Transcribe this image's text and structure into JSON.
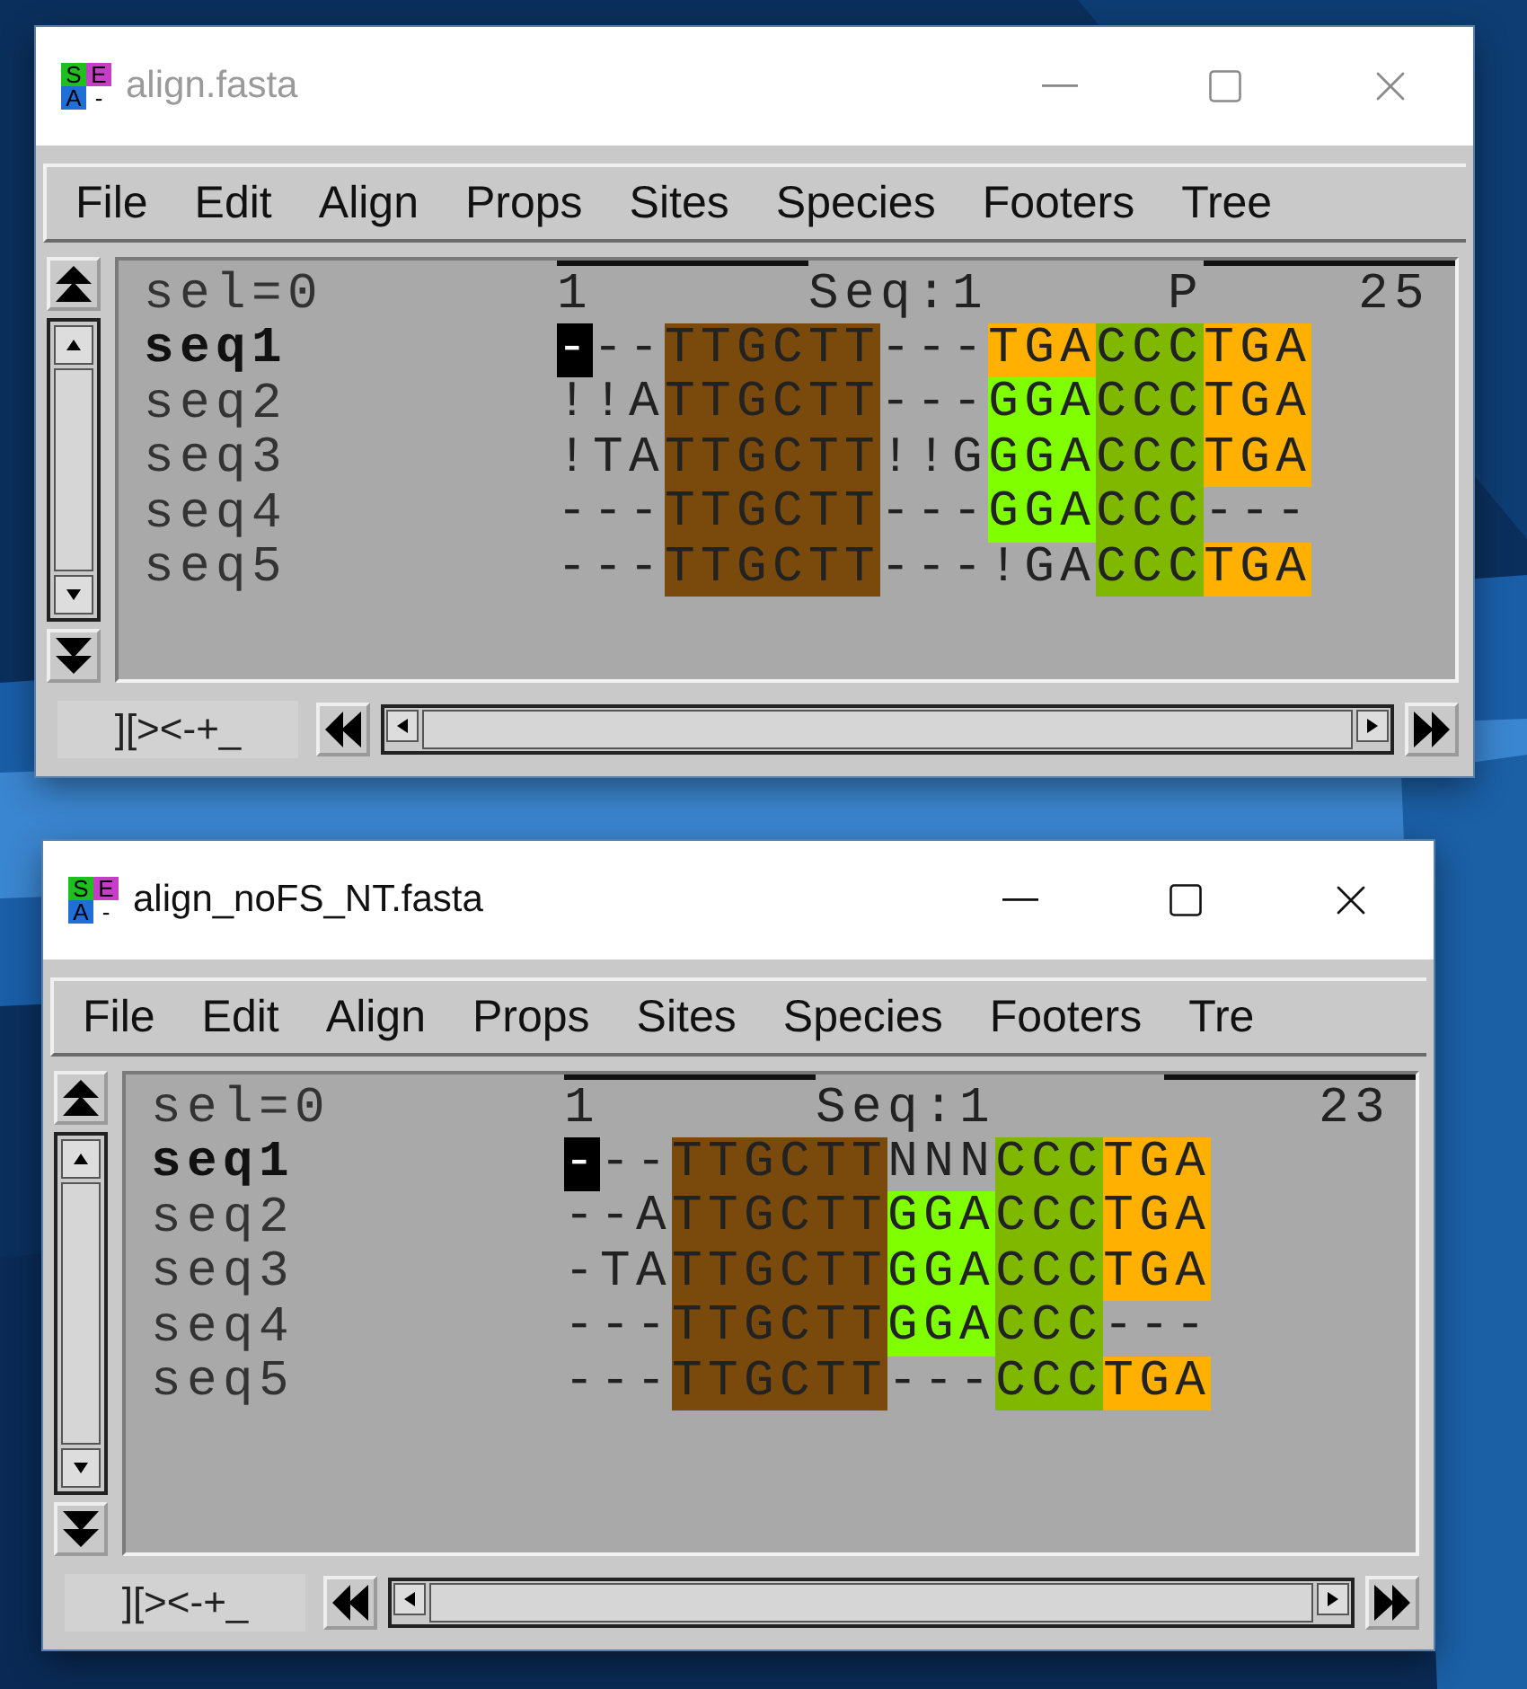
{
  "windows": [
    {
      "title": "align.fasta",
      "active": false,
      "logo": [
        "S",
        "E",
        "A",
        "-"
      ],
      "menu": [
        "File",
        "Edit",
        "Align",
        "Props",
        "Sites",
        "Species",
        "Footers",
        "Tree"
      ],
      "header": {
        "selection": "sel=0",
        "ruler": [
          "1",
          "Seq:1",
          "P"
        ],
        "length": "25"
      },
      "sequences": [
        {
          "name": "seq1",
          "reference": true,
          "segments": [
            {
              "text": "-",
              "kind": "cursor"
            },
            {
              "text": "--"
            },
            {
              "text": "TTGCTT",
              "color": "#7a4a0c"
            },
            {
              "text": "---"
            },
            {
              "text": "TGA",
              "color": "#ffb000"
            },
            {
              "text": "CCC",
              "color": "#80b800"
            },
            {
              "text": "TGA",
              "color": "#ffb000"
            }
          ]
        },
        {
          "name": "seq2",
          "reference": false,
          "segments": [
            {
              "text": "!!A"
            },
            {
              "text": "TTGCTT",
              "color": "#7a4a0c"
            },
            {
              "text": "---"
            },
            {
              "text": "GGA",
              "color": "#80ff00"
            },
            {
              "text": "CCC",
              "color": "#80b800"
            },
            {
              "text": "TGA",
              "color": "#ffb000"
            }
          ]
        },
        {
          "name": "seq3",
          "reference": false,
          "segments": [
            {
              "text": "!TA"
            },
            {
              "text": "TTGCTT",
              "color": "#7a4a0c"
            },
            {
              "text": "!!G"
            },
            {
              "text": "GGA",
              "color": "#80ff00"
            },
            {
              "text": "CCC",
              "color": "#80b800"
            },
            {
              "text": "TGA",
              "color": "#ffb000"
            }
          ]
        },
        {
          "name": "seq4",
          "reference": false,
          "segments": [
            {
              "text": "---"
            },
            {
              "text": "TTGCTT",
              "color": "#7a4a0c"
            },
            {
              "text": "---"
            },
            {
              "text": "GGA",
              "color": "#80ff00"
            },
            {
              "text": "CCC",
              "color": "#80b800"
            },
            {
              "text": "---"
            }
          ]
        },
        {
          "name": "seq5",
          "reference": false,
          "segments": [
            {
              "text": "---"
            },
            {
              "text": "TTGCTT",
              "color": "#7a4a0c"
            },
            {
              "text": "---"
            },
            {
              "text": "!GA"
            },
            {
              "text": "CCC",
              "color": "#80b800"
            },
            {
              "text": "TGA",
              "color": "#ffb000"
            }
          ]
        }
      ],
      "toggle": "][><-+_"
    },
    {
      "title": "align_noFS_NT.fasta",
      "active": true,
      "logo": [
        "S",
        "E",
        "A",
        "-"
      ],
      "menu": [
        "File",
        "Edit",
        "Align",
        "Props",
        "Sites",
        "Species",
        "Footers",
        "Tre"
      ],
      "header": {
        "selection": "sel=0",
        "ruler": [
          "1",
          "Seq:1"
        ],
        "length": "23"
      },
      "sequences": [
        {
          "name": "seq1",
          "reference": true,
          "segments": [
            {
              "text": "-",
              "kind": "cursor"
            },
            {
              "text": "--"
            },
            {
              "text": "TTGCTT",
              "color": "#7a4a0c"
            },
            {
              "text": "NNN"
            },
            {
              "text": "CCC",
              "color": "#80b800"
            },
            {
              "text": "TGA",
              "color": "#ffb000"
            }
          ]
        },
        {
          "name": "seq2",
          "reference": false,
          "segments": [
            {
              "text": "--A"
            },
            {
              "text": "TTGCTT",
              "color": "#7a4a0c"
            },
            {
              "text": "GGA",
              "color": "#80ff00"
            },
            {
              "text": "CCC",
              "color": "#80b800"
            },
            {
              "text": "TGA",
              "color": "#ffb000"
            }
          ]
        },
        {
          "name": "seq3",
          "reference": false,
          "segments": [
            {
              "text": "-TA"
            },
            {
              "text": "TTGCTT",
              "color": "#7a4a0c"
            },
            {
              "text": "GGA",
              "color": "#80ff00"
            },
            {
              "text": "CCC",
              "color": "#80b800"
            },
            {
              "text": "TGA",
              "color": "#ffb000"
            }
          ]
        },
        {
          "name": "seq4",
          "reference": false,
          "segments": [
            {
              "text": "---"
            },
            {
              "text": "TTGCTT",
              "color": "#7a4a0c"
            },
            {
              "text": "GGA",
              "color": "#80ff00"
            },
            {
              "text": "CCC",
              "color": "#80b800"
            },
            {
              "text": "---"
            }
          ]
        },
        {
          "name": "seq5",
          "reference": false,
          "segments": [
            {
              "text": "---"
            },
            {
              "text": "TTGCTT",
              "color": "#7a4a0c"
            },
            {
              "text": "---"
            },
            {
              "text": "CCC",
              "color": "#80b800"
            },
            {
              "text": "TGA",
              "color": "#ffb000"
            }
          ]
        }
      ],
      "toggle": "][><-+_"
    }
  ]
}
